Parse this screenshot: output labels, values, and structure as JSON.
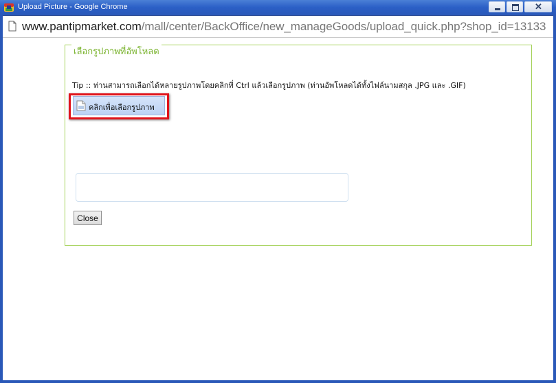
{
  "window": {
    "title": "Upload Picture - Google Chrome",
    "icon": "chrome-icon",
    "controls": [
      "minimize-icon",
      "maximize-icon",
      "close-icon"
    ]
  },
  "addressbar": {
    "url_host": "www.pantipmarket.com",
    "url_path": "/mall/center/BackOffice/new_manageGoods/upload_quick.php?shop_id=13133",
    "icon": "page-icon"
  },
  "upload": {
    "legend": "เลือกรูปภาพที่อัพโหลด",
    "tip": "Tip :: ท่านสามารถเลือกได้หลายรูปภาพโดยคลิกที่ Ctrl แล้วเลือกรูปภาพ (ท่านอัพโหลดได้ทั้งไฟล์นามสกุล .JPG และ .GIF)",
    "select_button_label": "คลิกเพื่อเลือกรูปภาพ",
    "close_button_label": "Close"
  },
  "colors": {
    "fieldset_border": "#a5d25a",
    "legend": "#7ab32e",
    "highlight": "#e0131b",
    "titlebar": "#2b5fc6"
  }
}
